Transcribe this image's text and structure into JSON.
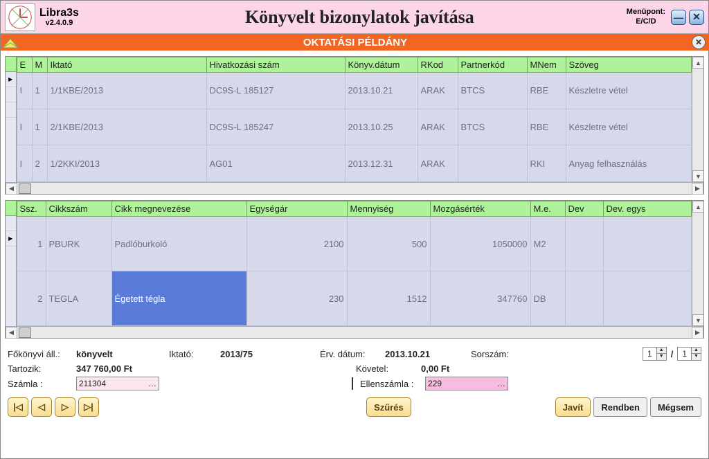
{
  "app": {
    "name": "Libra3s",
    "version": "v2.4.0.9",
    "title": "Könyvelt bizonylatok javítása",
    "menu_label": "Menüpont:",
    "menu_code": "E/C/D"
  },
  "banner": {
    "text": "OKTATÁSI PÉLDÁNY"
  },
  "grid1": {
    "headers": {
      "e": "E",
      "m": "M",
      "iktato": "Iktató",
      "hivszam": "Hivatkozási szám",
      "datum": "Könyv.dátum",
      "rkod": "RKod",
      "partner": "Partnerkód",
      "mnem": "MNem",
      "szoveg": "Szöveg"
    },
    "rows": [
      {
        "e": "I",
        "m": "1",
        "iktato": "1/1KBE/2013",
        "hivszam": "DC9S-L 185127",
        "datum": "2013.10.21",
        "rkod": "ARAK",
        "partner": "BTCS",
        "mnem": "RBE",
        "szoveg": "Készletre vétel"
      },
      {
        "e": "I",
        "m": "1",
        "iktato": "2/1KBE/2013",
        "hivszam": "DC9S-L 185247",
        "datum": "2013.10.25",
        "rkod": "ARAK",
        "partner": "BTCS",
        "mnem": "RBE",
        "szoveg": "Készletre vétel"
      },
      {
        "e": "I",
        "m": "2",
        "iktato": "1/2KKI/2013",
        "hivszam": "AG01",
        "datum": "2013.12.31",
        "rkod": "ARAK",
        "partner": "",
        "mnem": "RKI",
        "szoveg": "Anyag felhasználás"
      }
    ]
  },
  "grid2": {
    "headers": {
      "ssz": "Ssz.",
      "cikkszam": "Cikkszám",
      "megnev": "Cikk megnevezése",
      "egysegar": "Egységár",
      "menny": "Mennyiség",
      "mozgas": "Mozgásérték",
      "me": "M.e.",
      "dev": "Dev",
      "devegy": "Dev. egys"
    },
    "rows": [
      {
        "ssz": "1",
        "cikkszam": "PBURK",
        "megnev": "Padlóburkoló",
        "egysegar": "2100",
        "menny": "500",
        "mozgas": "1050000",
        "me": "M2",
        "dev": "",
        "devegy": ""
      },
      {
        "ssz": "2",
        "cikkszam": "TEGLA",
        "megnev": "Égetett tégla",
        "egysegar": "230",
        "menny": "1512",
        "mozgas": "347760",
        "me": "DB",
        "dev": "",
        "devegy": ""
      }
    ]
  },
  "status": {
    "fkonyv_label": "Főkönyvi áll.:",
    "fkonyv_value": "könyvelt",
    "iktato_label": "Iktató:",
    "iktato_value": "2013/75",
    "erv_label": "Érv. dátum:",
    "erv_value": "2013.10.21",
    "sorszam_label": "Sorszám:",
    "sorszam_a": "1",
    "sorszam_b": "1",
    "tartozik_label": "Tartozik:",
    "tartozik_value": "347 760,00 Ft",
    "kovetel_label": "Követel:",
    "kovetel_value": "0,00 Ft",
    "szamla_label": "Számla :",
    "szamla_value": "211304",
    "ellenszamla_label": "Ellenszámla :",
    "ellenszamla_value": "229"
  },
  "buttons": {
    "szures": "Szűrés",
    "javit": "Javít",
    "rendben": "Rendben",
    "megsem": "Mégsem"
  }
}
